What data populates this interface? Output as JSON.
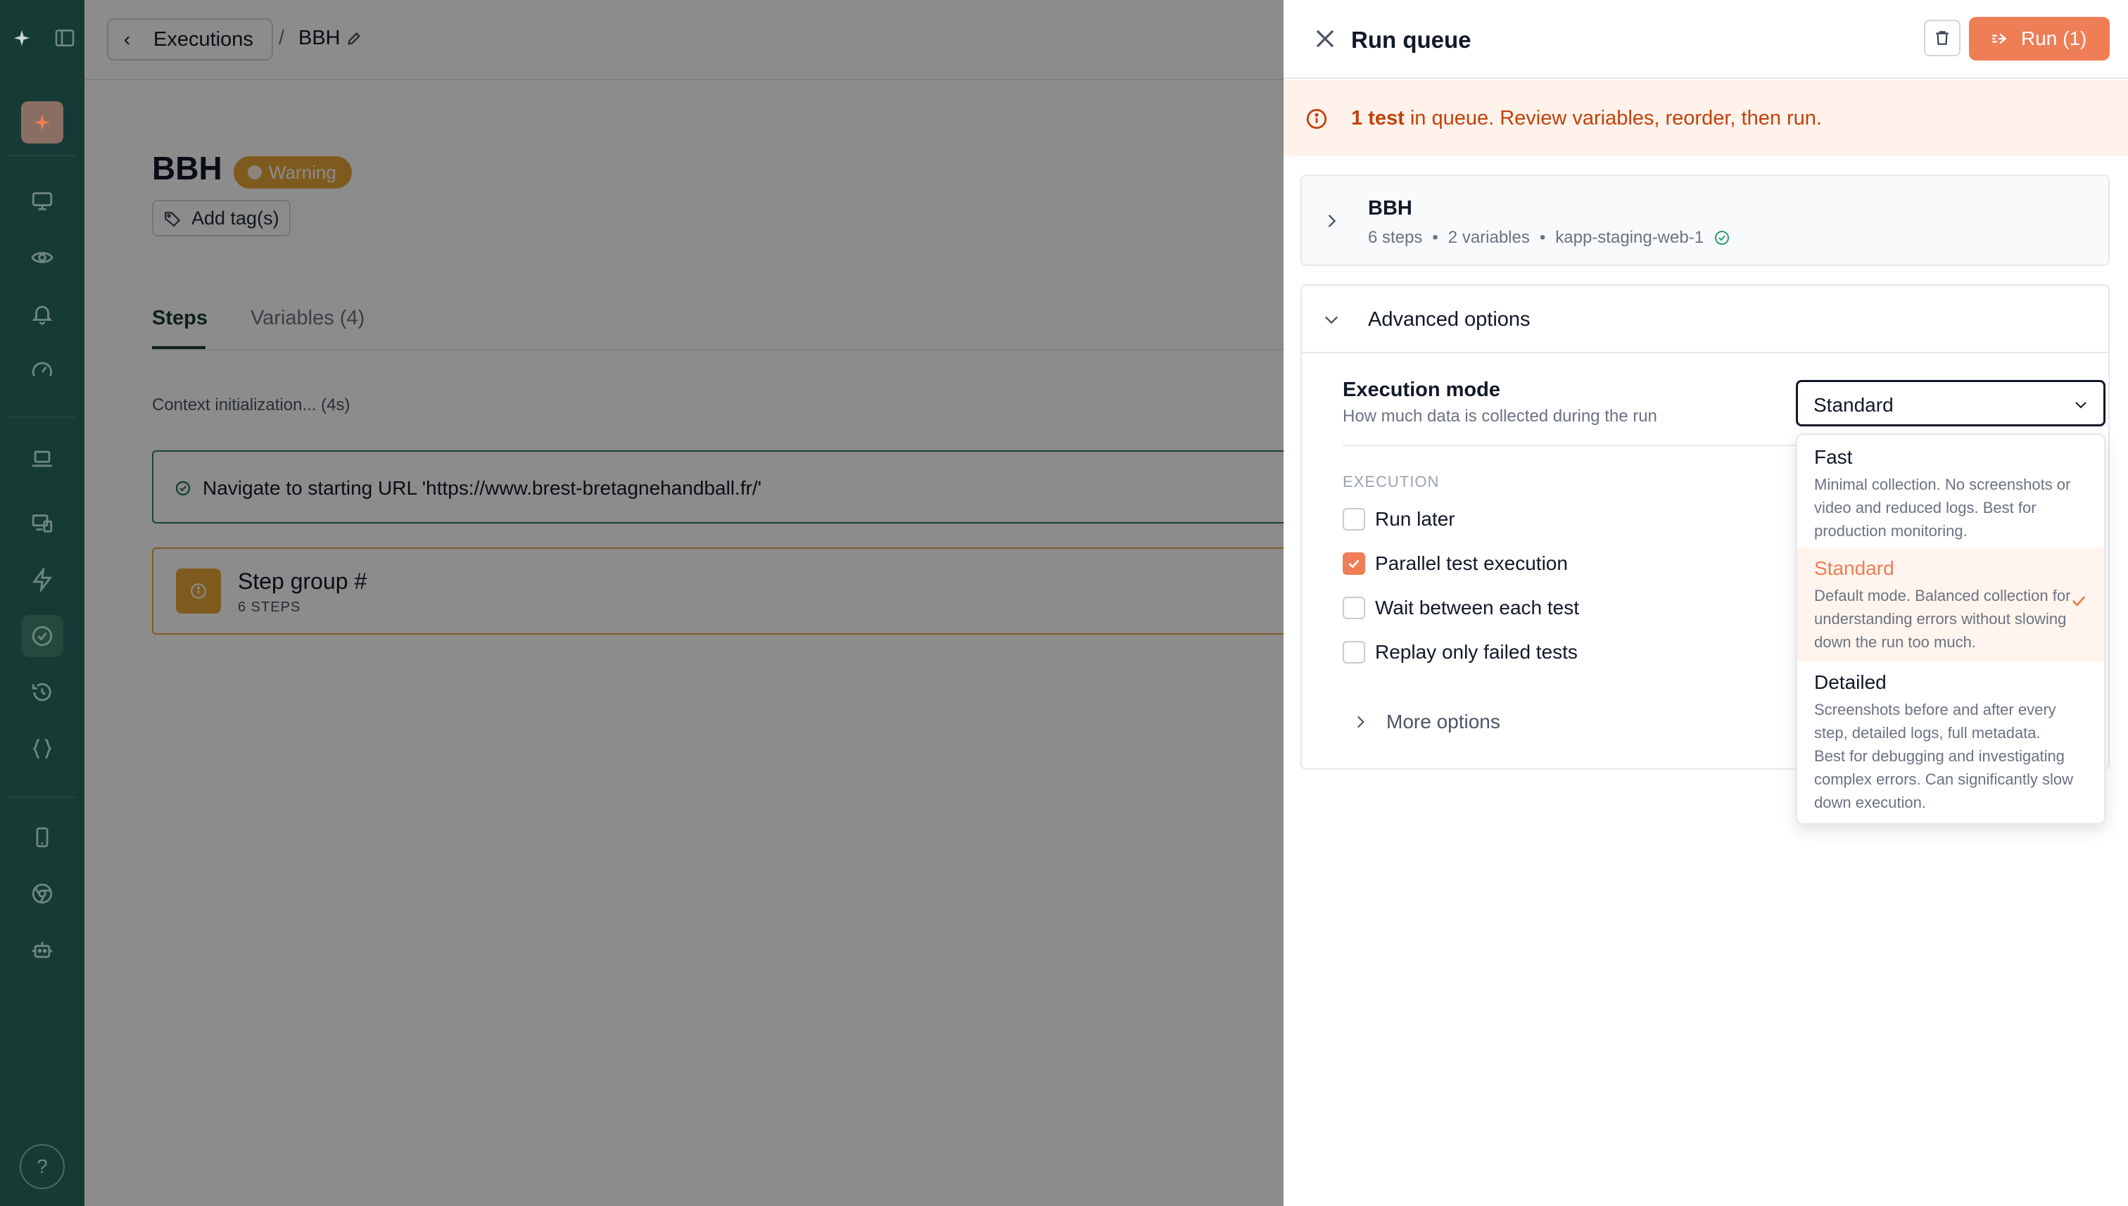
{
  "breadcrumb": {
    "back_label": "Executions",
    "separator": "/",
    "current": "BBH"
  },
  "page": {
    "title": "BBH",
    "status_badge": "Warning",
    "add_tag_label": "Add tag(s)",
    "tabs": [
      {
        "label": "Steps",
        "active": true
      },
      {
        "label": "Variables (4)",
        "active": false
      }
    ],
    "context_text": "Context initialization... (4s)",
    "navigate_step": "Navigate to starting URL 'https://www.brest-bretagnehandball.fr/'",
    "step_group": {
      "title": "Step group #",
      "subtitle": "6 STEPS"
    }
  },
  "drawer": {
    "title": "Run queue",
    "run_label": "Run (1)",
    "info": {
      "count": "1 test",
      "rest": " in queue. Review variables, reorder, then run."
    },
    "test": {
      "name": "BBH",
      "steps": "6 steps",
      "variables": "2 variables",
      "environment": "kapp-staging-web-1"
    },
    "advanced": {
      "title": "Advanced options",
      "execution_mode_label": "Execution mode",
      "execution_mode_desc": "How much data is collected during the run",
      "selected_mode": "Standard",
      "section_label": "EXECUTION",
      "options": [
        {
          "label": "Run later",
          "checked": false
        },
        {
          "label": "Parallel test execution",
          "checked": true
        },
        {
          "label": "Wait between each test",
          "checked": false
        },
        {
          "label": "Replay only failed tests",
          "checked": false
        }
      ],
      "more_options_label": "More options",
      "modes": [
        {
          "name": "Fast",
          "desc": "Minimal collection. No screenshots or video and reduced logs. Best for production monitoring."
        },
        {
          "name": "Standard",
          "desc": "Default mode. Balanced collection for understanding errors without slowing down the run too much."
        },
        {
          "name": "Detailed",
          "desc": "Screenshots before and after every step, detailed logs, full metadata. Best for debugging and investigating complex errors. Can significantly slow down execution."
        }
      ]
    }
  },
  "colors": {
    "accent": "#ef7d55",
    "sidebar": "#163a34",
    "warning": "#e8a53a",
    "success": "#2f7a5c"
  },
  "icons": [
    "logo-icon",
    "panel-toggle-icon",
    "monitor-icon",
    "eye-icon",
    "bell-icon",
    "gauge-icon",
    "laptop-icon",
    "devices-icon",
    "bolt-icon",
    "check-circle-icon",
    "history-icon",
    "braces-icon",
    "phone-icon",
    "chrome-icon",
    "robot-icon",
    "help-icon",
    "close-icon",
    "trash-icon",
    "run-icon",
    "info-icon",
    "chevron-right-icon",
    "chevron-down-icon",
    "check-icon",
    "tag-icon",
    "pencil-icon"
  ]
}
